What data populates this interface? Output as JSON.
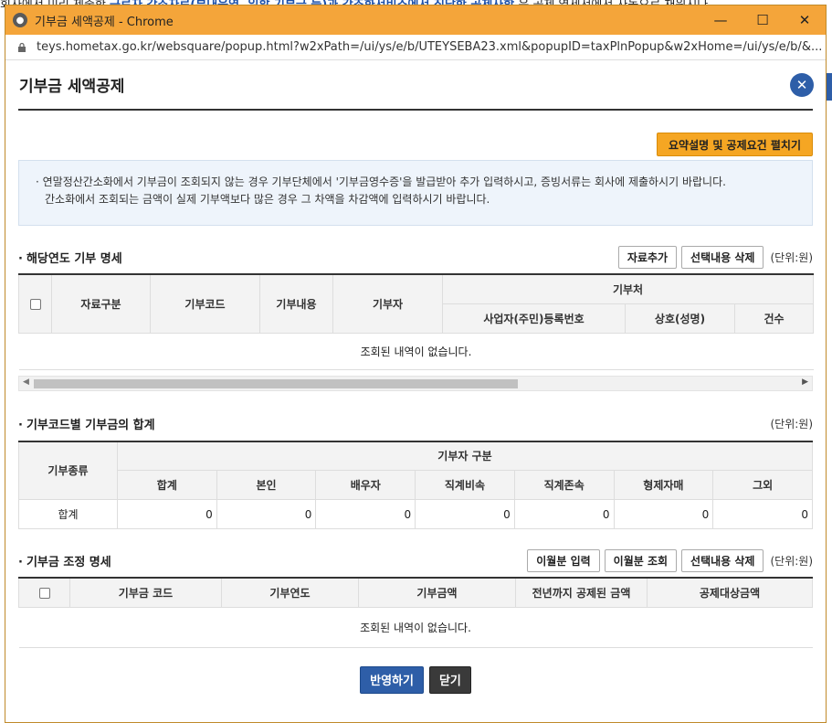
{
  "background": {
    "line_start": "회사에서 미리 제출한",
    "line_hl": "근로자 간소자료(부내운영, 일할 기부금 등)과 간조화서비스에서 직당한 공제사항",
    "line_end": "은 공제 영세서에서 자동으로 채워지다."
  },
  "window": {
    "title": "기부금 세액공제 - Chrome",
    "url": "teys.hometax.go.kr/websquare/popup.html?w2xPath=/ui/ys/e/b/UTEYSEBA23.xml&popupID=taxPlnPopup&w2xHome=/ui/ys/e/b/&...",
    "minimize_glyph": "—",
    "maximize_glyph": "☐",
    "close_glyph": "✕"
  },
  "popup": {
    "title": "기부금 세액공제",
    "close_glyph": "✕",
    "summary_button": "요약설명 및 공제요건 펼치기",
    "notice_line1": "· 연말정산간소화에서 기부금이 조회되지 않는 경우 기부단체에서 '기부금영수증'을 발급받아 추가 입력하시고, 증빙서류는 회사에 제출하시기 바랍니다.",
    "notice_line2": "간소화에서 조회되는 금액이 실제 기부액보다 많은 경우 그 차액을 차감액에 입력하시기 바랍니다."
  },
  "section1": {
    "title": "해당연도 기부 명세",
    "add_button": "자료추가",
    "delete_button": "선택내용 삭제",
    "unit": "(단위:원)",
    "headers": {
      "data_type": "자료구분",
      "code": "기부코드",
      "content": "기부내용",
      "donor": "기부자",
      "recipient": "기부처",
      "biz_no": "사업자(주민)등록번호",
      "name": "상호(성명)",
      "count": "건수"
    },
    "empty": "조회된 내역이 없습니다."
  },
  "section2": {
    "title": "기부코드별 기부금의 합계",
    "unit": "(단위:원)",
    "headers": {
      "type": "기부종류",
      "donor_group": "기부자 구분",
      "cols": [
        "합계",
        "본인",
        "배우자",
        "직계비속",
        "직계존속",
        "형제자매",
        "그외"
      ]
    },
    "row_label": "합계",
    "row_values": [
      "0",
      "0",
      "0",
      "0",
      "0",
      "0",
      "0"
    ]
  },
  "section3": {
    "title": "기부금 조정 명세",
    "carry_input_button": "이월분 입력",
    "carry_view_button": "이월분 조회",
    "delete_button": "선택내용 삭제",
    "unit": "(단위:원)",
    "headers": [
      "기부금 코드",
      "기부연도",
      "기부금액",
      "전년까지 공제된 금액",
      "공제대상금액"
    ],
    "empty": "조회된 내역이 없습니다."
  },
  "footer": {
    "apply_button": "반영하기",
    "close_button": "닫기"
  }
}
